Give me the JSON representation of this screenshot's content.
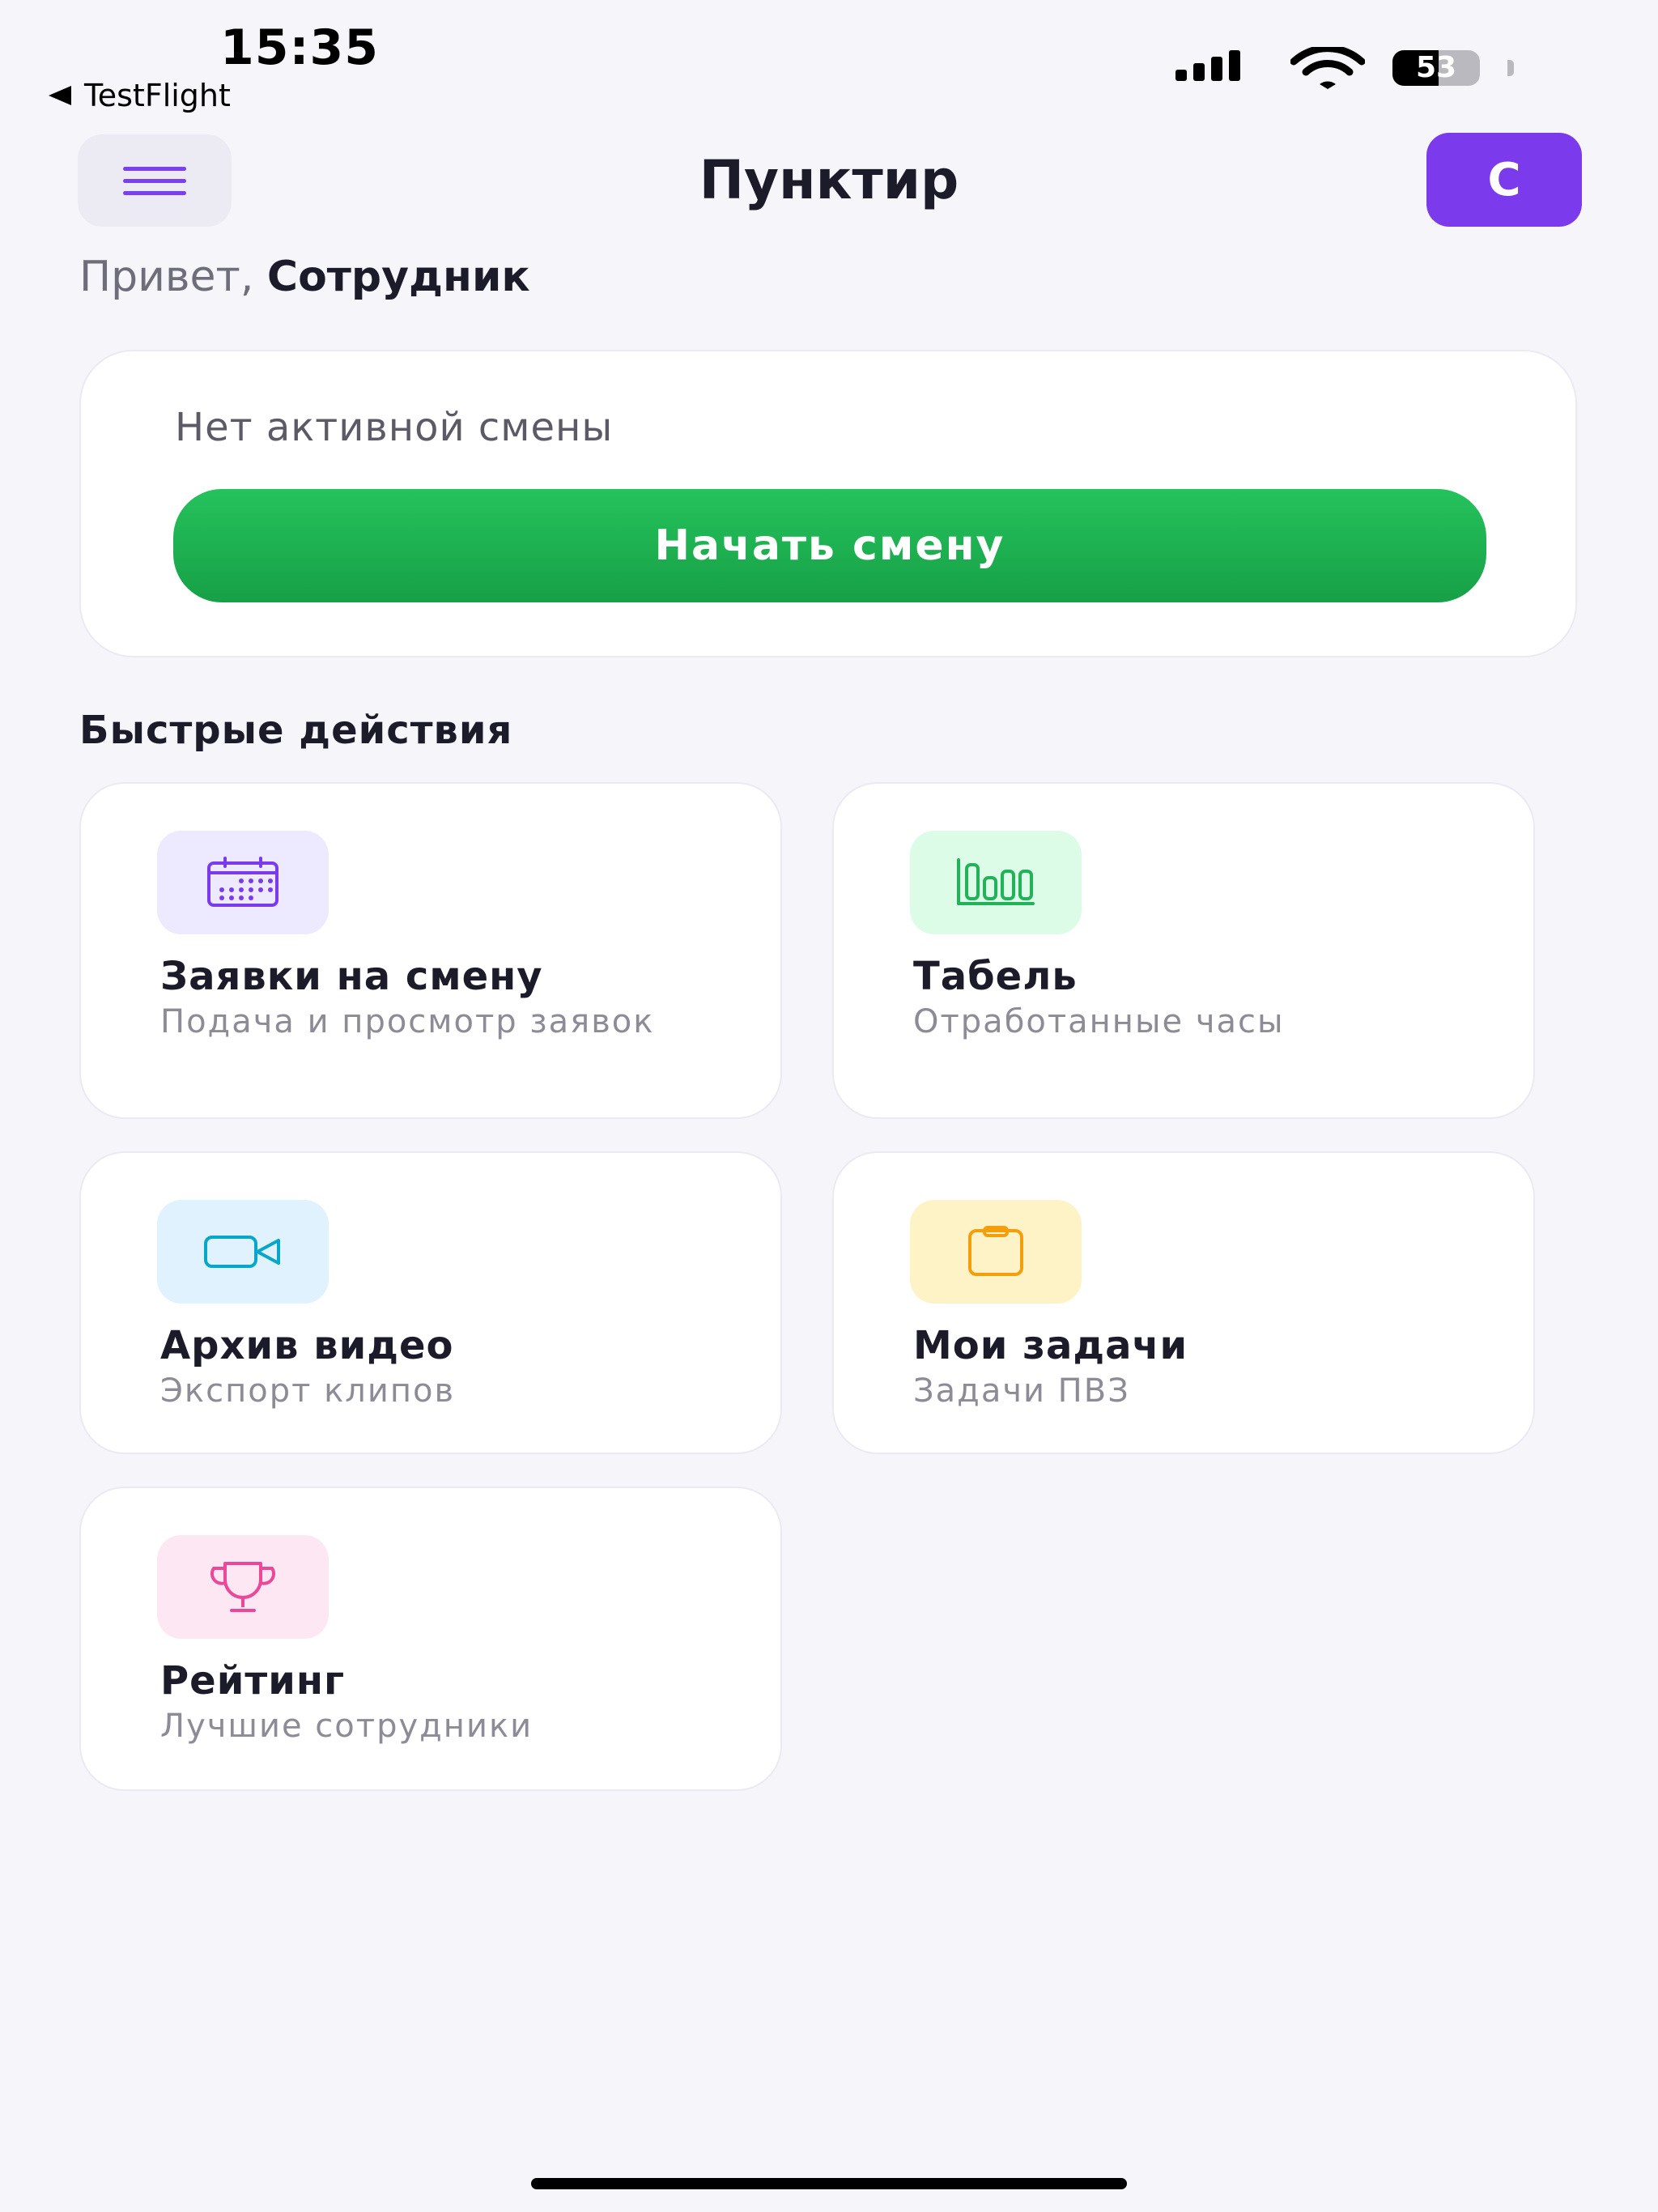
{
  "status_bar": {
    "time": "15:35",
    "back_app": "TestFlight",
    "battery_percent": "53"
  },
  "header": {
    "title": "Пунктир",
    "avatar_initial": "С"
  },
  "greeting": {
    "hello": "Привет,",
    "name": "Сотрудник"
  },
  "shift": {
    "status": "Нет активной смены",
    "start_label": "Начать смену"
  },
  "quick_actions": {
    "title": "Быстрые действия",
    "items": [
      {
        "title": "Заявки на смену",
        "subtitle": "Подача и просмотр заявок",
        "icon": "calendar-icon",
        "bg": "#ede9fe",
        "fg": "#7c3aed"
      },
      {
        "title": "Табель",
        "subtitle": "Отработанные часы",
        "icon": "bar-chart-icon",
        "bg": "#dcfce7",
        "fg": "#22b35a"
      },
      {
        "title": "Архив видео",
        "subtitle": "Экспорт клипов",
        "icon": "video-camera-icon",
        "bg": "#e0f2fe",
        "fg": "#06a7c9"
      },
      {
        "title": "Мои задачи",
        "subtitle": "Задачи ПВЗ",
        "icon": "clipboard-icon",
        "bg": "#fef3c7",
        "fg": "#f59e0b"
      },
      {
        "title": "Рейтинг",
        "subtitle": "Лучшие сотрудники",
        "icon": "trophy-icon",
        "bg": "#fce7f3",
        "fg": "#ec4899"
      }
    ]
  },
  "colors": {
    "accent": "#7c3aed",
    "start_button": "#1fb453",
    "background": "#f6f5fa"
  }
}
